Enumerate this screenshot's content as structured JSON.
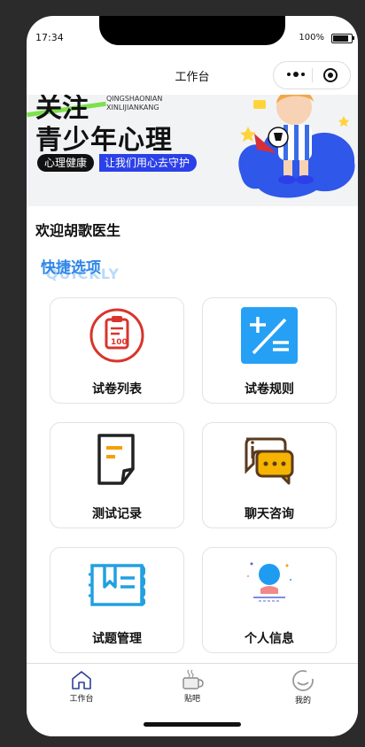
{
  "status_bar": {
    "time": "17:34",
    "battery": "100%"
  },
  "nav": {
    "title": "工作台"
  },
  "banner": {
    "line1": "关注",
    "line2": "青少年心理",
    "pinyin1": "QINGSHAONIAN",
    "pinyin2": "XINLIJIANKANG",
    "tag": "心理健康",
    "slogan": "让我们用心去守护"
  },
  "welcome": "欢迎胡歌医生",
  "quick": {
    "title": "快捷选项",
    "subtitle": "QUICKLY"
  },
  "cards": [
    {
      "label": "试卷列表",
      "icon": "clipboard-score-icon"
    },
    {
      "label": "试卷规则",
      "icon": "plus-minus-icon"
    },
    {
      "label": "测试记录",
      "icon": "document-icon"
    },
    {
      "label": "聊天咨询",
      "icon": "chat-bubbles-icon"
    },
    {
      "label": "试题管理",
      "icon": "book-icon"
    },
    {
      "label": "个人信息",
      "icon": "user-icon"
    }
  ],
  "tabbar": [
    {
      "label": "工作台",
      "icon": "home-icon"
    },
    {
      "label": "贴吧",
      "icon": "coffee-cup-icon"
    },
    {
      "label": "我的",
      "icon": "profile-circle-icon"
    }
  ],
  "colors": {
    "accent": "#2f86e8",
    "banner_blue": "#2b40e8",
    "red": "#d9342b",
    "orange": "#f5a000"
  }
}
